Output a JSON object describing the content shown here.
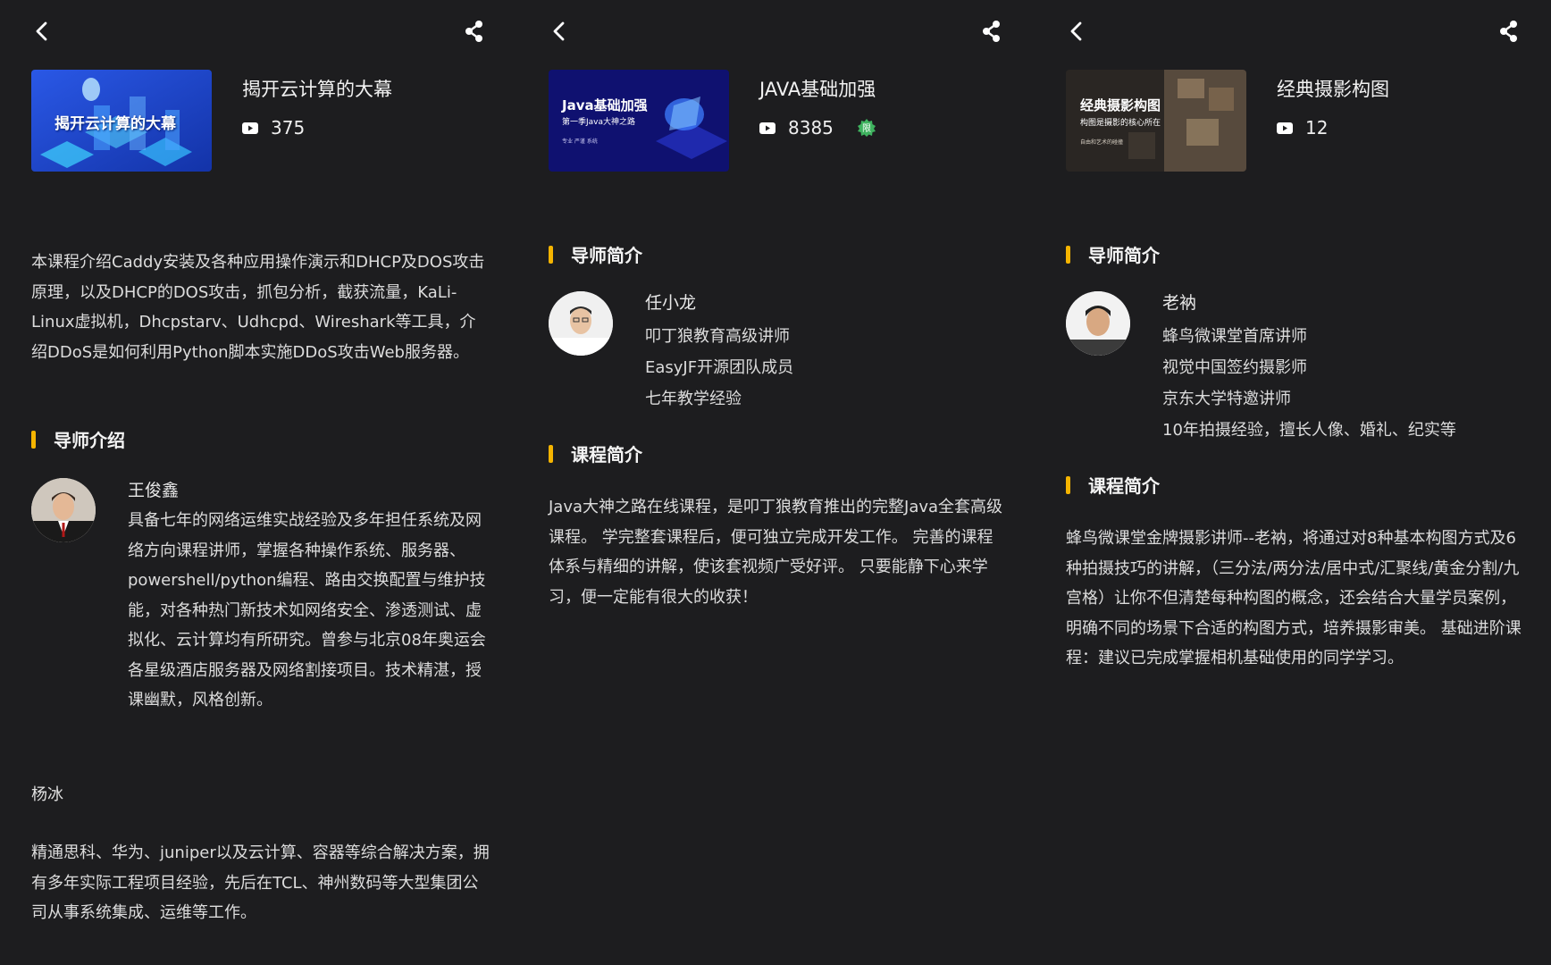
{
  "screens": [
    {
      "course_title": "揭开云计算的大幕",
      "video_count": "375",
      "cover_text": "揭开云计算的大幕",
      "description": "本课程介绍Caddy安装及各种应用操作演示和DHCP及DOS攻击原理，以及DHCP的DOS攻击，抓包分析，截获流量，KaLi-Linux虚拟机，Dhcpstarv、Udhcpd、Wireshark等工具，介绍DDoS是如何利用Python脚本实施DDoS攻击Web服务器。",
      "section_instructor": "导师介绍",
      "instructor1_name": "王俊鑫",
      "instructor1_bio": "具备七年的网络运维实战经验及多年担任系统及网络方向课程讲师，掌握各种操作系统、服务器、powershell/python编程、路由交换配置与维护技能，对各种热门新技术如网络安全、渗透测试、虚拟化、云计算均有所研究。曾参与北京08年奥运会各星级酒店服务器及网络割接项目。技术精湛，授课幽默，风格创新。",
      "instructor2_name": "杨冰",
      "instructor2_bio": "精通思科、华为、juniper以及云计算、容器等综合解决方案，拥有多年实际工程项目经验，先后在TCL、神州数码等大型集团公司从事系统集成、运维等工作。"
    },
    {
      "course_title": "JAVA基础加强",
      "video_count": "8385",
      "badge_text": "限",
      "cover_title": "Java基础加强",
      "cover_subtitle": "第一季Java大神之路",
      "cover_small": "专业 严谨 系统",
      "section_instructor": "导师简介",
      "instructor_name": "任小龙",
      "instructor_lines": [
        "叩丁狼教育高级讲师",
        "EasyJF开源团队成员",
        "七年教学经验"
      ],
      "section_course": "课程简介",
      "course_desc": "Java大神之路在线课程，是叩丁狼教育推出的完整Java全套高级课程。 学完整套课程后，便可独立完成开发工作。 完善的课程体系与精细的讲解，使该套视频广受好评。 只要能静下心来学习，便一定能有很大的收获！"
    },
    {
      "course_title": "经典摄影构图",
      "video_count": "12",
      "cover_title": "经典摄影构图",
      "cover_subtitle": "构图是摄影的核心所在",
      "cover_small": "自由和艺术的碰撞",
      "section_instructor": "导师简介",
      "instructor_name": "老衲",
      "instructor_lines": [
        "蜂鸟微课堂首席讲师",
        "视觉中国签约摄影师",
        "京东大学特邀讲师",
        "10年拍摄经验，擅长人像、婚礼、纪实等"
      ],
      "section_course": "课程简介",
      "course_desc": "蜂鸟微课堂金牌摄影讲师--老衲，将通过对8种基本构图方式及6种拍摄技巧的讲解，（三分法/两分法/居中式/汇聚线/黄金分割/九宫格）让你不但清楚每种构图的概念，还会结合大量学员案例，明确不同的场景下合适的构图方式，培养摄影审美。 基础进阶课程：建议已完成掌握相机基础使用的同学学习。"
    }
  ],
  "colors": {
    "background": "#1d1d1f",
    "accent_bar": "#f5b400",
    "badge": "#3fb35f"
  }
}
